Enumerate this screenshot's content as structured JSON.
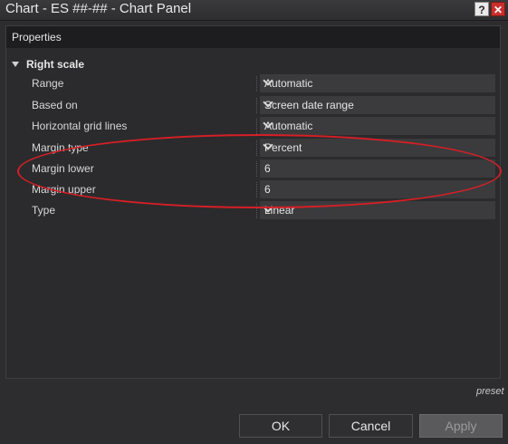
{
  "window": {
    "title": "Chart - ES ##-## - Chart Panel",
    "help_label": "?",
    "close_label": "✕"
  },
  "properties": {
    "header": "Properties",
    "section": "Right scale",
    "rows": [
      {
        "label": "Range",
        "value": "Automatic",
        "type": "dropdown"
      },
      {
        "label": "Based on",
        "value": "Screen date range",
        "type": "dropdown"
      },
      {
        "label": "Horizontal grid lines",
        "value": "Automatic",
        "type": "dropdown"
      },
      {
        "label": "Margin type",
        "value": "Percent",
        "type": "dropdown"
      },
      {
        "label": "Margin lower",
        "value": "6",
        "type": "text"
      },
      {
        "label": "Margin upper",
        "value": "6",
        "type": "text"
      },
      {
        "label": "Type",
        "value": "Linear",
        "type": "dropdown"
      }
    ]
  },
  "footer": {
    "preset": "preset",
    "ok_label": "OK",
    "cancel_label": "Cancel",
    "apply_label": "Apply"
  },
  "colors": {
    "background": "#2d2d2f",
    "field": "#3b3b3d",
    "highlight": "#d61f26",
    "close_button": "#c9302c"
  },
  "icons": [
    "help-icon",
    "close-icon",
    "collapse-triangle-icon",
    "chevron-down-icon"
  ]
}
